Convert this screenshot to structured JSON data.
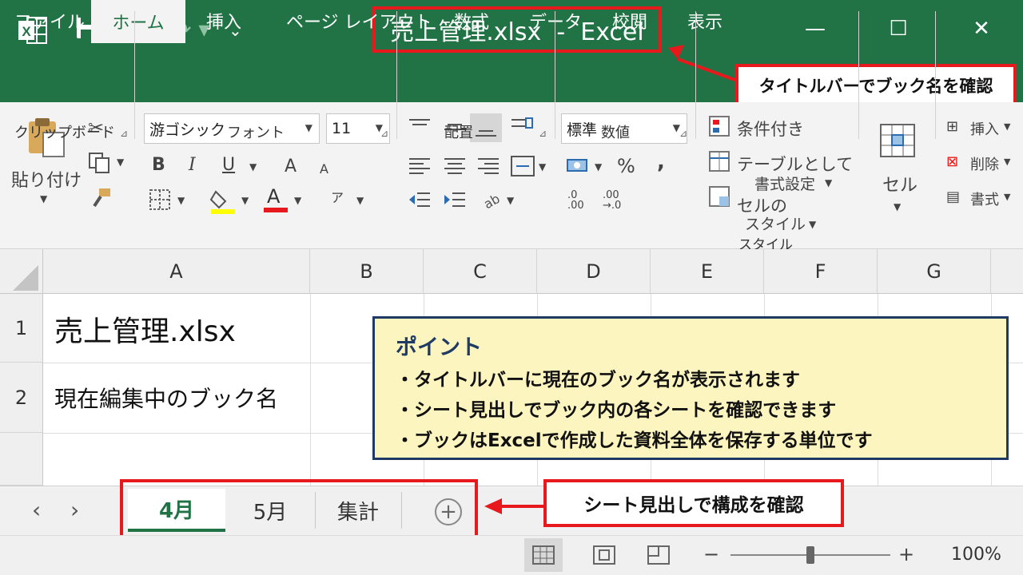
{
  "window": {
    "title": "売上管理.xlsx  -  Excel",
    "minimize": "—",
    "maximize": "☐",
    "close": "✕",
    "undo_label": "↶ ▾",
    "redo_label": "↷ ▾",
    "qat_more": "⌄"
  },
  "tabs": [
    "ファイル",
    "ホーム",
    "挿入",
    "ページ レイアウト",
    "数式",
    "データ",
    "校閲",
    "表示"
  ],
  "active_tab": "ホーム",
  "ribbon": {
    "clipboard": {
      "paste": "貼り付け",
      "label": "クリップボード"
    },
    "font": {
      "name": "游ゴシック",
      "size": "11",
      "bold": "B",
      "italic": "I",
      "underline": "U",
      "grow": "A",
      "shrink": "A",
      "font_color": "A",
      "phonetic": "ア",
      "label": "フォント",
      "highlight_color": "#ffff00",
      "font_color_hex": "#e8191c"
    },
    "alignment": {
      "label": "配置"
    },
    "number": {
      "format": "標準",
      "percent": "%",
      "comma": ",",
      "inc_dec": ".0\n.00",
      "dec_dec": ".00\n→.0",
      "label": "数値"
    },
    "styles": {
      "conditional": "条件付き",
      "as_table_1": "テーブルとして",
      "as_table_2": "書式設定",
      "cell_1": "セルの",
      "cell_2": "スタイル",
      "label": "スタイル"
    },
    "cells": {
      "cell": "セル",
      "insert": "挿入",
      "delete": "削除",
      "format": "書式"
    }
  },
  "callouts": {
    "titlebar": "タイトルバーでブック名を確認",
    "sheets": "シート見出しで構成を確認"
  },
  "columns": [
    "A",
    "B",
    "C",
    "D",
    "E",
    "F",
    "G"
  ],
  "rows": [
    "1",
    "2"
  ],
  "cells": {
    "A1": "売上管理.xlsx",
    "A2": "現在編集中のブック名"
  },
  "point": {
    "title": "ポイント",
    "lines": [
      "・タイトルバーに現在のブック名が表示されます",
      "・シート見出しでブック内の各シートを確認できます",
      "・ブックはExcelで作成した資料全体を保存する単位です"
    ]
  },
  "sheet_tabs": [
    "4月",
    "5月",
    "集計"
  ],
  "active_sheet": "4月",
  "add_sheet": "+",
  "status": {
    "zoom": "100%",
    "zoom_out": "−",
    "zoom_in": "+",
    "zoom_level": 0.5
  },
  "colors": {
    "accent": "#217346",
    "annotation": "#e8191c",
    "point_bg": "#fdf5bf",
    "point_border": "#1f3a64"
  }
}
